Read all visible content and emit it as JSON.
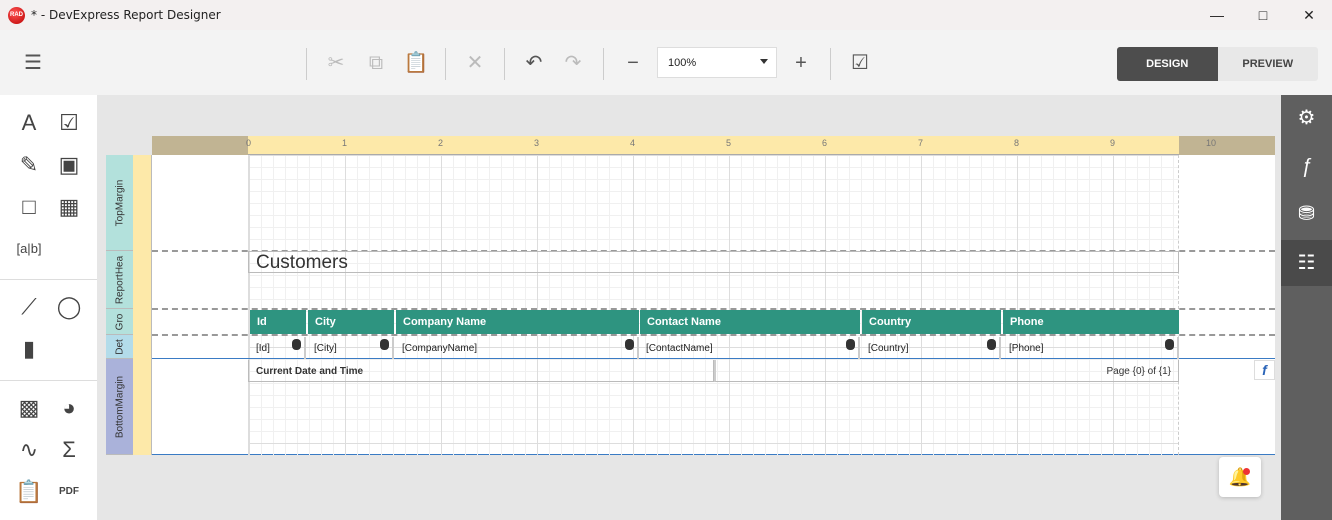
{
  "window": {
    "title": "* - DevExpress Report Designer",
    "logo": "RAD"
  },
  "toolbar": {
    "zoom": "100%",
    "design": "DESIGN",
    "preview": "PREVIEW"
  },
  "ruler": [
    "0",
    "1",
    "2",
    "3",
    "4",
    "5",
    "6",
    "7",
    "8",
    "9",
    "10"
  ],
  "bands": {
    "top": "TopMargin",
    "report_header": "ReportHea",
    "group": "Gro",
    "detail": "Det",
    "bottom": "BottomMargin"
  },
  "report": {
    "title": "Customers",
    "headers": [
      "Id",
      "City",
      "Company Name",
      "Contact Name",
      "Country",
      "Phone"
    ],
    "fields": [
      "[Id]",
      "[City]",
      "[CompanyName]",
      "[ContactName]",
      "[Country]",
      "[Phone]"
    ],
    "footer_left": "Current Date and Time",
    "footer_right": "Page {0} of {1}"
  },
  "colors": {
    "header": "#2e9480",
    "active_mode": "#4d4d4d",
    "right_panel": "#5f5f5f"
  }
}
